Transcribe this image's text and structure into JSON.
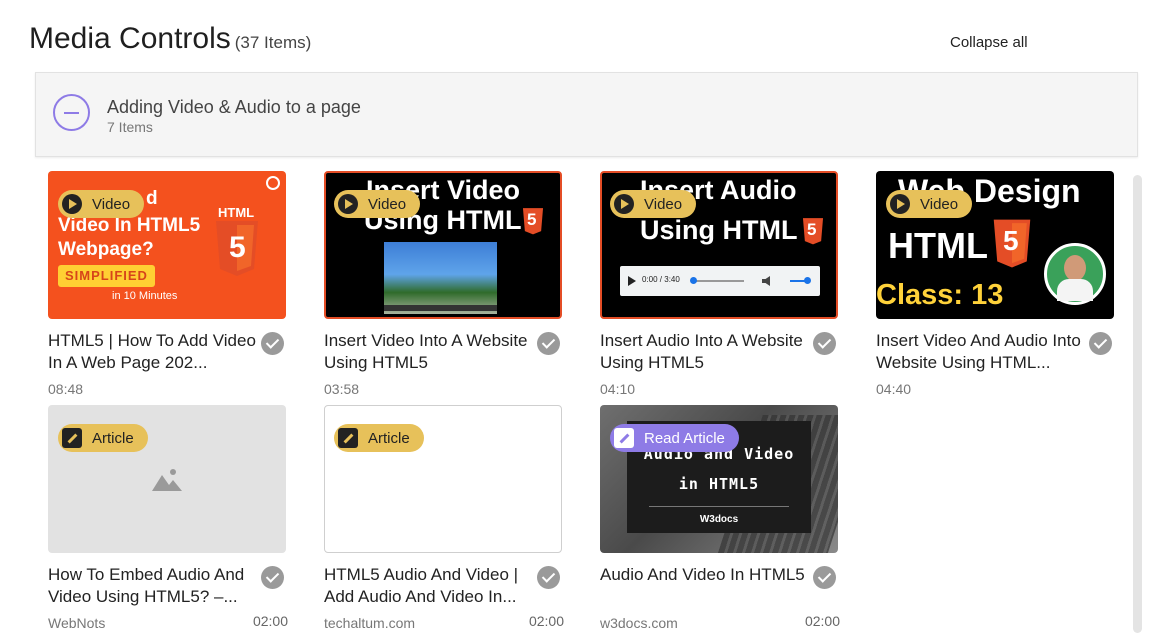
{
  "header": {
    "title": "Media Controls",
    "count": "(37 Items)",
    "collapse_label": "Collapse all"
  },
  "section": {
    "title": "Adding Video & Audio to a page",
    "subtitle": "7 Items"
  },
  "cards": [
    {
      "badge": "Video",
      "thumb": {
        "line1": "d",
        "line2": "Video In HTML5",
        "line3": "Webpage?",
        "chip": "SIMPLIFIED",
        "foot": "in 10 Minutes",
        "logo_text": "HTML",
        "shield": "5"
      },
      "title": "HTML5 | How To Add Video In A Web Page 202...",
      "meta_left": "08:48",
      "meta_right": ""
    },
    {
      "badge": "Video",
      "thumb": {
        "line1": "Insert Video",
        "line2": "Using HTML",
        "shield": "5"
      },
      "title": "Insert Video Into A Website Using HTML5",
      "meta_left": "03:58",
      "meta_right": ""
    },
    {
      "badge": "Video",
      "thumb": {
        "line1": "Insert Audio",
        "line2": "Using HTML",
        "shield": "5",
        "time": "0:00 / 3:40"
      },
      "title": "Insert Audio Into A Website Using HTML5",
      "meta_left": "04:10",
      "meta_right": ""
    },
    {
      "badge": "Video",
      "thumb": {
        "line1": "Web Design",
        "line2": "HTML",
        "line3": "Class: 13",
        "shield": "5"
      },
      "title": "Insert Video And Audio Into Website Using HTML...",
      "meta_left": "04:40",
      "meta_right": ""
    },
    {
      "badge": "Article",
      "title": "How To Embed Audio And Video Using HTML5? –...",
      "meta_left": "WebNots",
      "meta_right": "02:00"
    },
    {
      "badge": "Article",
      "title": "HTML5 Audio And Video | Add Audio And Video In...",
      "meta_left": "techaltum.com",
      "meta_right": "02:00"
    },
    {
      "badge": "Read Article",
      "thumb": {
        "line1": "Audio and Video",
        "line2": "in HTML5",
        "brand": "W3docs"
      },
      "title": "Audio And Video In HTML5",
      "meta_left": "w3docs.com",
      "meta_right": "02:00"
    }
  ],
  "colors": {
    "accent": "#8e7be6",
    "badge": "#e7c15a",
    "check": "#9a9a9a",
    "orange": "#f4511e",
    "html5": "#e44d26"
  }
}
